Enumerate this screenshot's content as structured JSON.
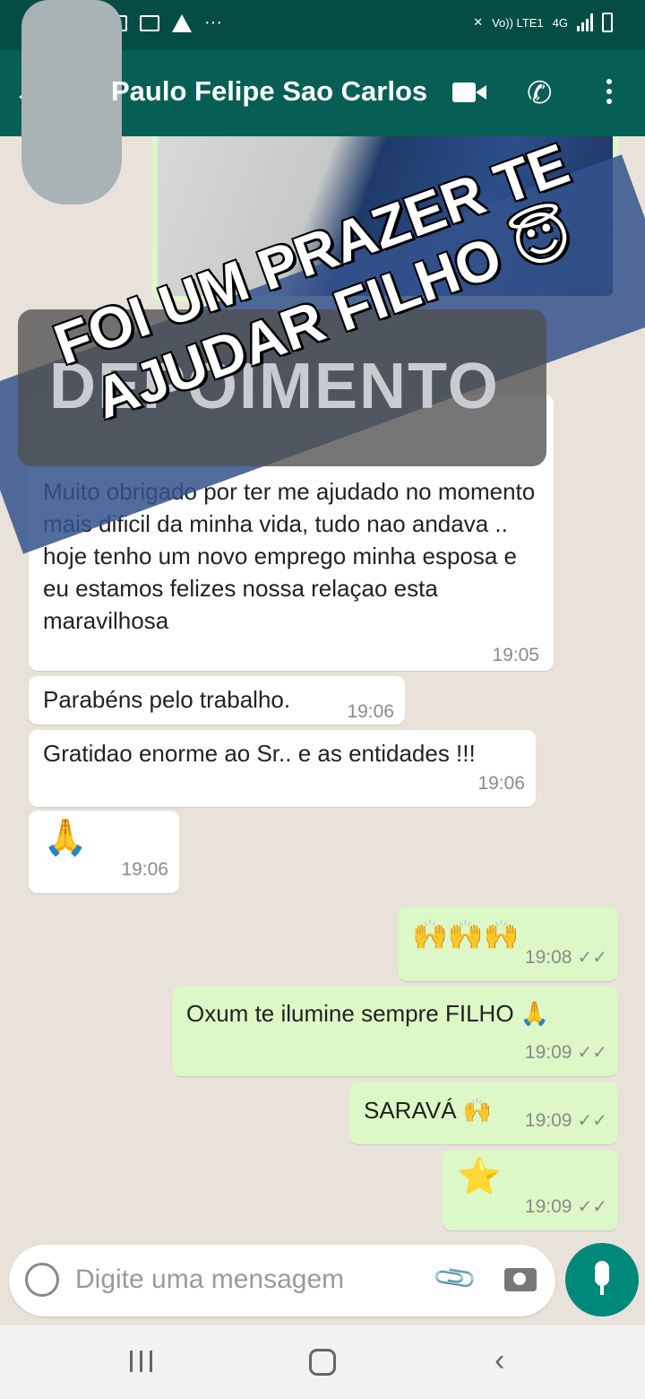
{
  "contact": {
    "name": "Paulo Felipe Sao Carlos"
  },
  "overlay": {
    "banner_line1": "FOI UM PRAZER TE",
    "banner_line2": "AJUDAR FILHO 😇",
    "label": "DEPOIMENTO"
  },
  "messages": [
    {
      "direction": "in",
      "text": "Muito obrigado por ter me ajudado no momento mais dificil da minha vida, tudo nao andava .. hoje tenho um novo emprego minha esposa e eu estamos felizes nossa relaçao esta maravilhosa",
      "time": "19:05"
    },
    {
      "direction": "in",
      "text": "Parabéns pelo trabalho.",
      "time": "19:06"
    },
    {
      "direction": "in",
      "text": "Gratidao enorme ao Sr.. e as entidades !!!",
      "time": "19:06"
    },
    {
      "direction": "in",
      "text": "🙏",
      "time": "19:06"
    },
    {
      "direction": "out",
      "text": "🙌🙌🙌",
      "time": "19:08"
    },
    {
      "direction": "out",
      "text": "Oxum te ilumine sempre FILHO 🙏",
      "time": "19:09"
    },
    {
      "direction": "out",
      "text": "SARAVÁ 🙌",
      "time": "19:09"
    },
    {
      "direction": "out",
      "text": "⭐",
      "time": "19:09"
    }
  ],
  "composer": {
    "placeholder": "Digite uma mensagem"
  },
  "status_bar": {
    "network": "4G",
    "carrier": "Vo)) LTE1"
  }
}
